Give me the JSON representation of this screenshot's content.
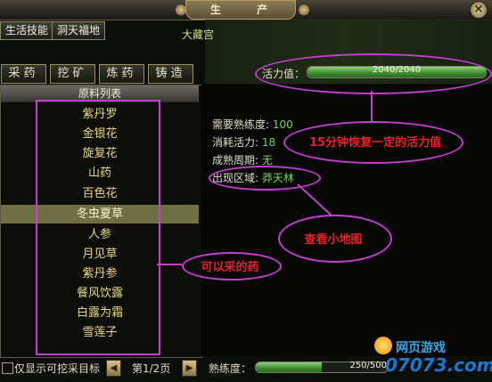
{
  "window": {
    "title": "生 产",
    "close_label": "×"
  },
  "top_tabs": [
    {
      "label": "生活技能"
    },
    {
      "label": "洞天福地"
    }
  ],
  "background_text": "大藏宫",
  "sub_tabs": [
    {
      "label": "采药"
    },
    {
      "label": "挖矿"
    },
    {
      "label": "炼药"
    },
    {
      "label": "铸造"
    }
  ],
  "list": {
    "header": "原料列表",
    "items": [
      "紫丹罗",
      "金银花",
      "旋复花",
      "山药",
      "百色花",
      "冬虫夏草",
      "人参",
      "月见草",
      "紫丹参",
      "餐风饮露",
      "白露为霜",
      "雪莲子"
    ],
    "selected_index": 5
  },
  "vigor": {
    "label": "活力值：",
    "value_text": "2040/2040",
    "fraction": 1.0
  },
  "details": {
    "proficiency_req": {
      "label": "需要熟练度:",
      "value": "100"
    },
    "vigor_cost": {
      "label": "消耗活力:",
      "value": "18"
    },
    "mature_cycle": {
      "label": "成熟周期:",
      "value": "无"
    },
    "region": {
      "label": "出现区域:",
      "value": "莽天林"
    }
  },
  "annotations": {
    "vigor_note": "15分钟恢复一定的活力值",
    "map_note": "查看小地图",
    "herb_note": "可以采的药"
  },
  "footer": {
    "checkbox_label": "仅显示可挖采目标",
    "page_text": "第1/2页",
    "prev_icon": "◀",
    "next_icon": "▶",
    "proficiency_label": "熟练度：",
    "proficiency_value": "250/500",
    "proficiency_fraction": 0.5
  },
  "watermark": {
    "line1": "网页游戏",
    "line2": "07073.com"
  },
  "colors": {
    "accent_annotation": "#c23fd0",
    "annotation_text": "#e8202a",
    "value_green": "#7fd05a",
    "item_text": "#e7d98a"
  }
}
